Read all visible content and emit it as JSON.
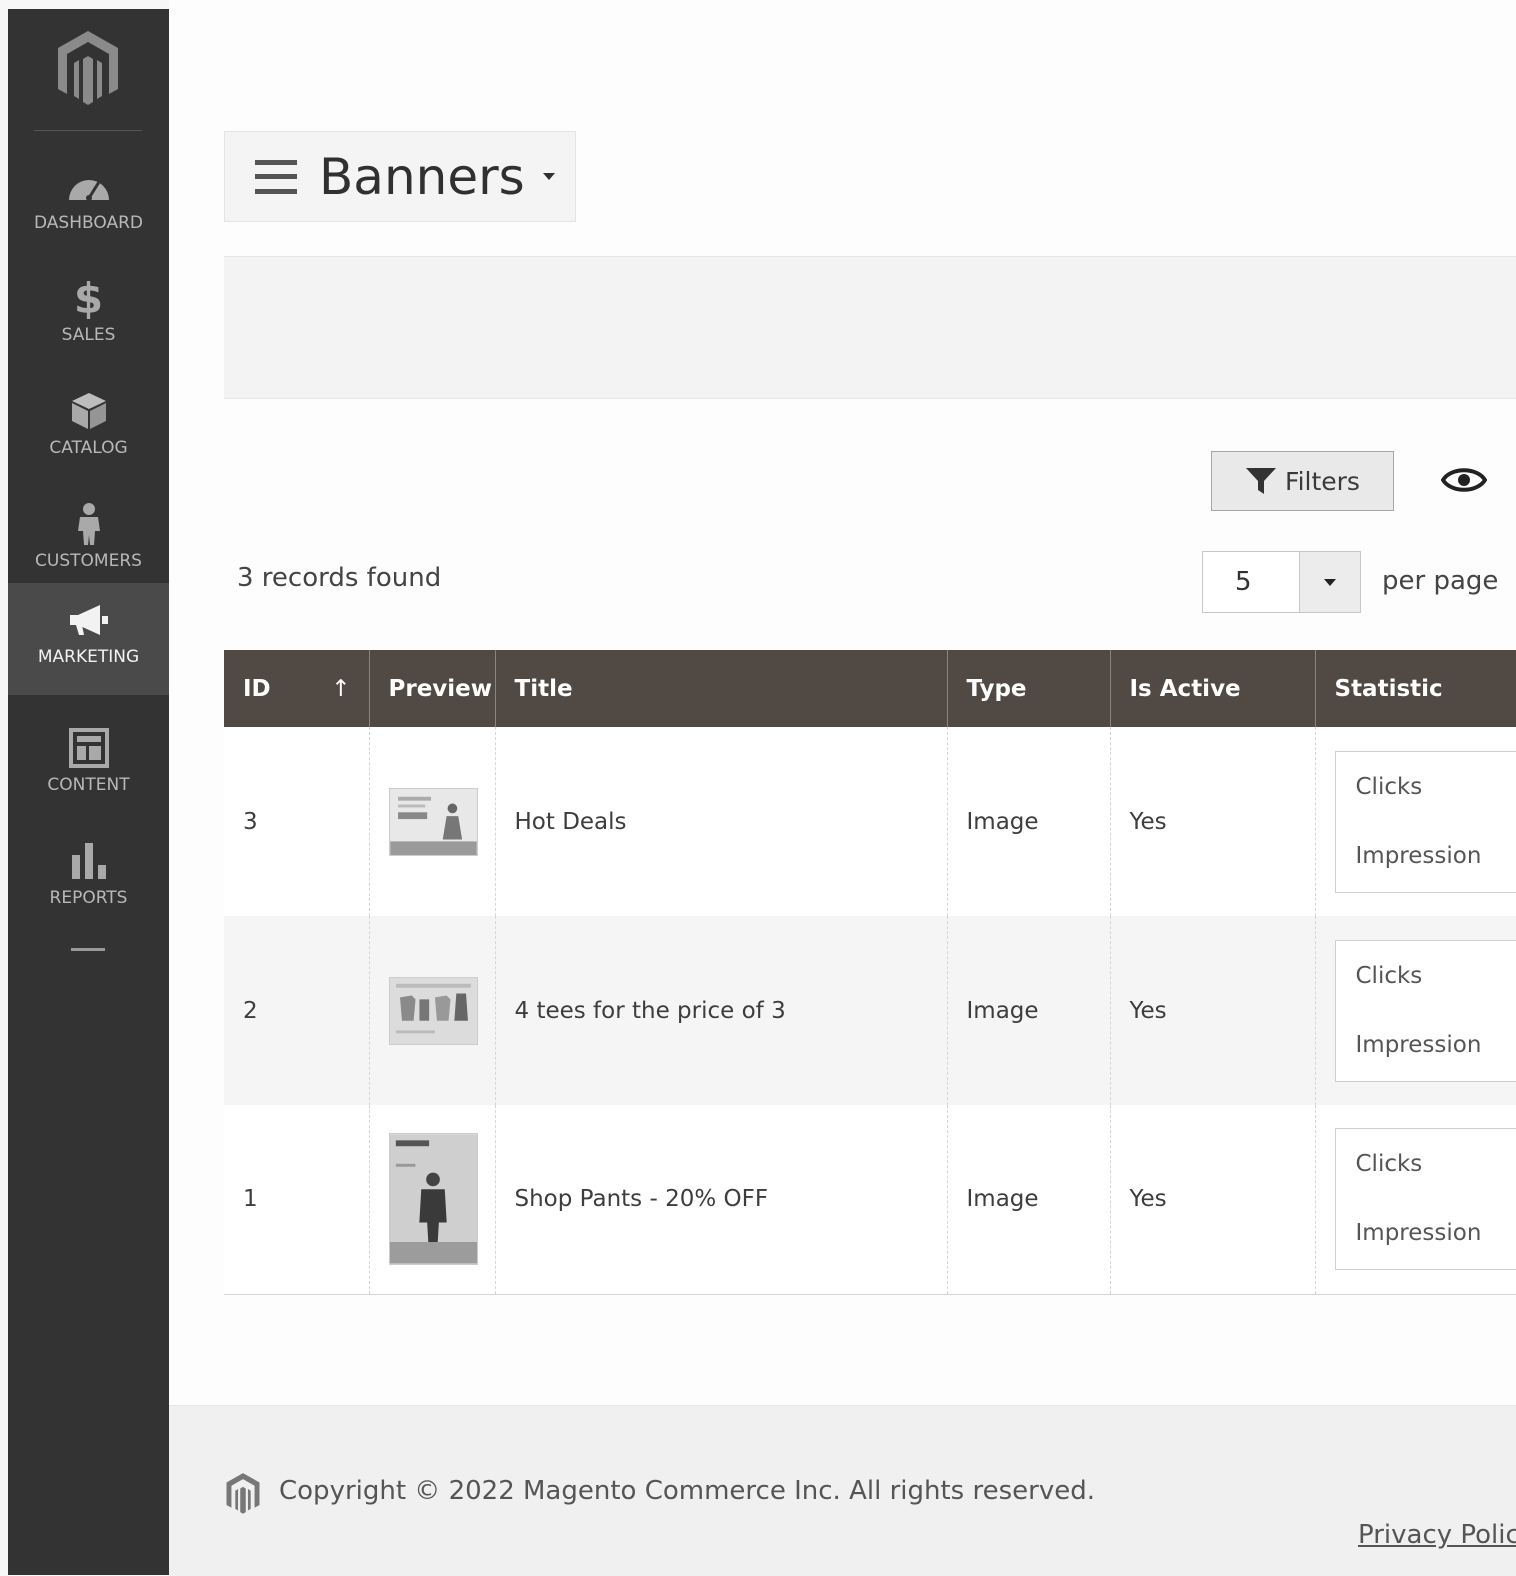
{
  "sidebar": {
    "items": [
      {
        "label": "DASHBOARD",
        "icon": "dashboard-icon"
      },
      {
        "label": "SALES",
        "icon": "dollar-icon"
      },
      {
        "label": "CATALOG",
        "icon": "box-icon"
      },
      {
        "label": "CUSTOMERS",
        "icon": "person-icon"
      },
      {
        "label": "MARKETING",
        "icon": "megaphone-icon",
        "active": true
      },
      {
        "label": "CONTENT",
        "icon": "layout-icon"
      },
      {
        "label": "REPORTS",
        "icon": "bar-chart-icon"
      }
    ]
  },
  "header": {
    "title": "Banners"
  },
  "toolbar": {
    "filters_label": "Filters",
    "records_found": "3 records found",
    "per_page_value": "5",
    "per_page_label": "per page"
  },
  "grid": {
    "columns": [
      "ID",
      "Preview",
      "Title",
      "Type",
      "Is Active",
      "Statistic"
    ],
    "sort_indicator": "↑",
    "rows": [
      {
        "id": "3",
        "title": "Hot Deals",
        "type": "Image",
        "active": "Yes",
        "stat_clicks": "Clicks",
        "stat_impression": "Impression"
      },
      {
        "id": "2",
        "title": "4 tees for the price of 3",
        "type": "Image",
        "active": "Yes",
        "stat_clicks": "Clicks",
        "stat_impression": "Impression"
      },
      {
        "id": "1",
        "title": "Shop Pants - 20% OFF",
        "type": "Image",
        "active": "Yes",
        "stat_clicks": "Clicks",
        "stat_impression": "Impression"
      }
    ]
  },
  "footer": {
    "copyright": "Copyright © 2022 Magento Commerce Inc. All rights reserved.",
    "privacy": "Privacy Policy"
  },
  "colors": {
    "sidebar_bg": "#333333",
    "table_header_bg": "#514943",
    "active_nav_bg": "#4a4a4a"
  }
}
